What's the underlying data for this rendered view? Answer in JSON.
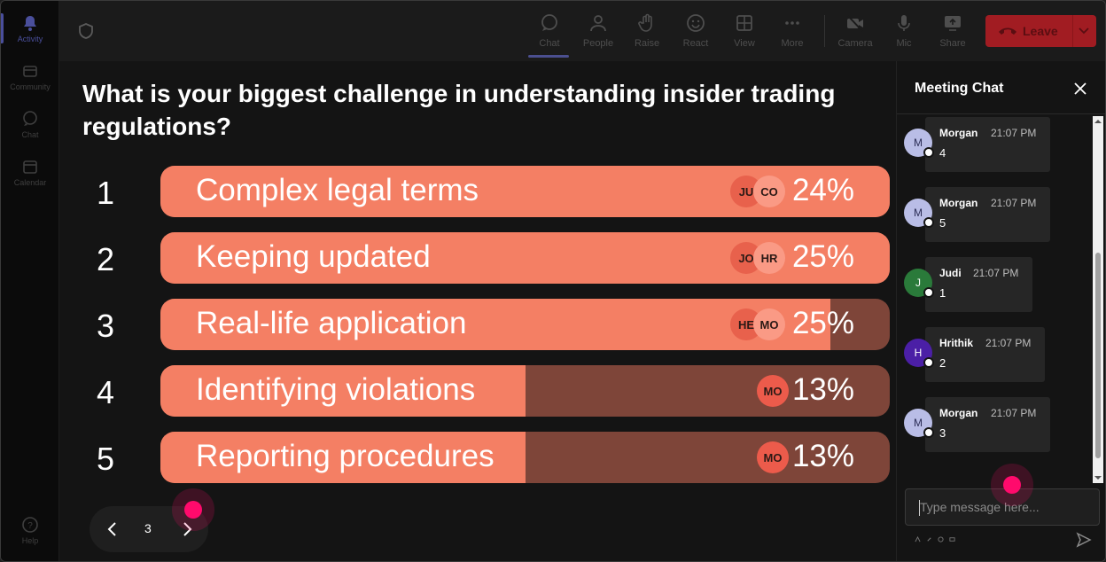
{
  "rail": {
    "items": [
      {
        "label": "Activity",
        "icon": "bell-icon",
        "active": true
      },
      {
        "label": "Community",
        "icon": "community-icon"
      },
      {
        "label": "Chat",
        "icon": "chat-icon"
      },
      {
        "label": "Calendar",
        "icon": "calendar-icon"
      },
      {
        "label": "Help",
        "icon": "help-icon"
      }
    ]
  },
  "toolbar": {
    "chat": "Chat",
    "people": "People",
    "raise": "Raise",
    "react": "React",
    "view": "View",
    "more": "More",
    "camera": "Camera",
    "mic": "Mic",
    "share": "Share",
    "leave": "Leave"
  },
  "poll": {
    "question": "What is your biggest challenge in understanding insider trading regulations?",
    "options": [
      {
        "num": "1",
        "label": "Complex legal terms",
        "percent": "24%",
        "fill": 1.0,
        "avatars": [
          "JU",
          "CO"
        ]
      },
      {
        "num": "2",
        "label": "Keeping updated",
        "percent": "25%",
        "fill": 1.0,
        "avatars": [
          "JO",
          "HR"
        ]
      },
      {
        "num": "3",
        "label": "Real-life application",
        "percent": "25%",
        "fill": 0.919,
        "avatars": [
          "HE",
          "MO"
        ]
      },
      {
        "num": "4",
        "label": "Identifying violations",
        "percent": "13%",
        "fill": 0.5,
        "avatars": [
          "MO"
        ]
      },
      {
        "num": "5",
        "label": "Reporting procedures",
        "percent": "13%",
        "fill": 0.5,
        "avatars": [
          "MO"
        ]
      }
    ],
    "page": "3"
  },
  "chat": {
    "title": "Meeting Chat",
    "placeholder": "Type message here...",
    "messages": [
      {
        "initial": "M",
        "name": "Morgan",
        "time": "21:07 PM",
        "text": "4",
        "color": "#b9bde6",
        "text_color": "#2a2c55"
      },
      {
        "initial": "M",
        "name": "Morgan",
        "time": "21:07 PM",
        "text": "5",
        "color": "#b9bde6",
        "text_color": "#2a2c55"
      },
      {
        "initial": "J",
        "name": "Judi",
        "time": "21:07 PM",
        "text": "1",
        "color": "#2a7a3a",
        "text_color": "#ffffff"
      },
      {
        "initial": "H",
        "name": "Hrithik",
        "time": "21:07 PM",
        "text": "2",
        "color": "#4b1fa6",
        "text_color": "#ffffff"
      },
      {
        "initial": "M",
        "name": "Morgan",
        "time": "21:07 PM",
        "text": "3",
        "color": "#b9bde6",
        "text_color": "#2a2c55"
      }
    ]
  },
  "colors": {
    "bar_fill": "#f47f64",
    "bar_track": "#7e4539",
    "leave": "#a11c22",
    "cursor_dot": "#ff0a6c"
  }
}
